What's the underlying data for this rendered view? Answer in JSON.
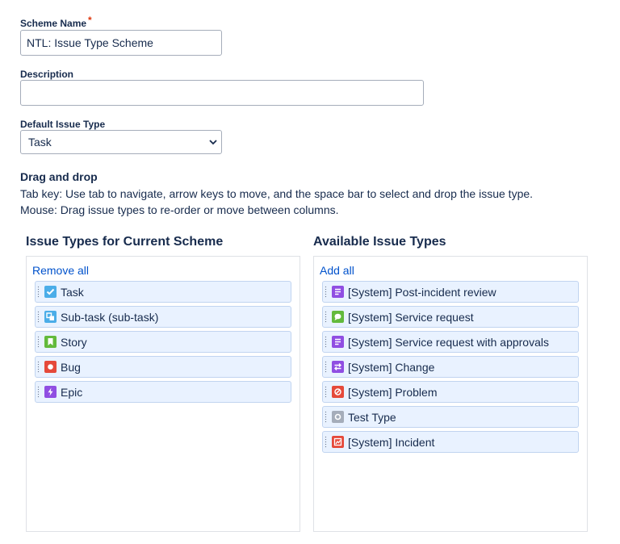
{
  "form": {
    "scheme_name_label": "Scheme Name",
    "required_marker": "*",
    "scheme_name_value": "NTL: Issue Type Scheme",
    "description_label": "Description",
    "description_value": "",
    "default_issue_type_label": "Default Issue Type",
    "default_issue_type_value": "Task"
  },
  "help": {
    "heading": "Drag and drop",
    "keyboard_line": "Tab key: Use tab to navigate, arrow keys to move, and the space bar to select and drop the issue type.",
    "mouse_line": "Mouse: Drag issue types to re-order or move between columns."
  },
  "current": {
    "title": "Issue Types for Current Scheme",
    "action": "Remove all",
    "items": [
      {
        "label": "Task",
        "icon": "task-icon",
        "color": "#4bade8"
      },
      {
        "label": "Sub-task (sub-task)",
        "icon": "subtask-icon",
        "color": "#4bade8"
      },
      {
        "label": "Story",
        "icon": "story-icon",
        "color": "#63ba3c"
      },
      {
        "label": "Bug",
        "icon": "bug-icon",
        "color": "#e5493a"
      },
      {
        "label": "Epic",
        "icon": "epic-icon",
        "color": "#904ee2"
      }
    ]
  },
  "available": {
    "title": "Available Issue Types",
    "action": "Add all",
    "items": [
      {
        "label": "[System] Post-incident review",
        "icon": "document-icon",
        "color": "#904ee2"
      },
      {
        "label": "[System] Service request",
        "icon": "chat-icon",
        "color": "#63ba3c"
      },
      {
        "label": "[System] Service request with approvals",
        "icon": "document-icon",
        "color": "#904ee2"
      },
      {
        "label": "[System] Change",
        "icon": "swap-icon",
        "color": "#904ee2"
      },
      {
        "label": "[System] Problem",
        "icon": "block-icon",
        "color": "#e5493a"
      },
      {
        "label": "Test Type",
        "icon": "circle-icon",
        "color": "#a5adba"
      },
      {
        "label": "[System] Incident",
        "icon": "alert-icon",
        "color": "#e5493a"
      }
    ]
  }
}
